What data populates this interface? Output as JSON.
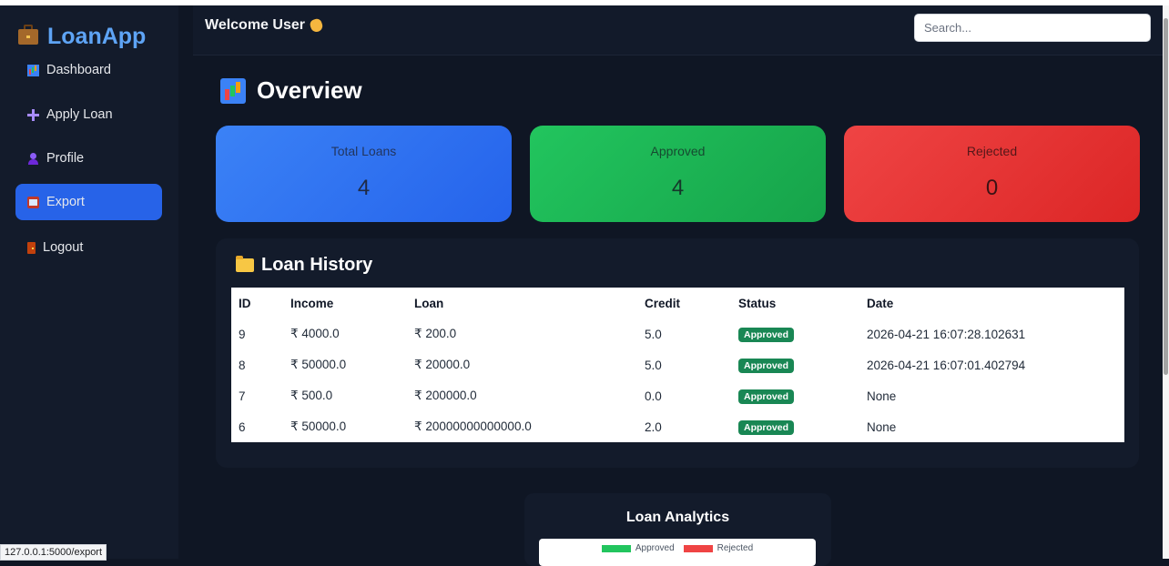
{
  "app": {
    "name": "LoanApp"
  },
  "sidebar": {
    "items": [
      {
        "label": "Dashboard",
        "icon": "dashboard-icon"
      },
      {
        "label": "Apply Loan",
        "icon": "plus-icon"
      },
      {
        "label": "Profile",
        "icon": "profile-icon"
      },
      {
        "label": "Export",
        "icon": "export-icon",
        "active": true
      },
      {
        "label": "Logout",
        "icon": "logout-icon"
      }
    ]
  },
  "header": {
    "welcome": "Welcome User",
    "search_placeholder": "Search..."
  },
  "overview": {
    "title": "Overview",
    "cards": [
      {
        "label": "Total Loans",
        "value": "4",
        "color": "#3b82f6"
      },
      {
        "label": "Approved",
        "value": "4",
        "color": "#22c55e"
      },
      {
        "label": "Rejected",
        "value": "0",
        "color": "#ef4444"
      }
    ]
  },
  "history": {
    "title": "Loan History",
    "columns": [
      "ID",
      "Income",
      "Loan",
      "Credit",
      "Status",
      "Date"
    ],
    "rows": [
      {
        "id": "9",
        "income": "₹ 4000.0",
        "loan": "₹ 200.0",
        "credit": "5.0",
        "status": "Approved",
        "date": "2026-04-21 16:07:28.102631"
      },
      {
        "id": "8",
        "income": "₹ 50000.0",
        "loan": "₹ 20000.0",
        "credit": "5.0",
        "status": "Approved",
        "date": "2026-04-21 16:07:01.402794"
      },
      {
        "id": "7",
        "income": "₹ 500.0",
        "loan": "₹ 200000.0",
        "credit": "0.0",
        "status": "Approved",
        "date": "None"
      },
      {
        "id": "6",
        "income": "₹ 50000.0",
        "loan": "₹ 20000000000000.0",
        "credit": "2.0",
        "status": "Approved",
        "date": "None"
      }
    ]
  },
  "analytics": {
    "title": "Loan Analytics",
    "legend": [
      {
        "label": "Approved",
        "color": "#22c55e"
      },
      {
        "label": "Rejected",
        "color": "#ef4444"
      }
    ]
  },
  "status_bar": {
    "url": "127.0.0.1:5000/export"
  }
}
